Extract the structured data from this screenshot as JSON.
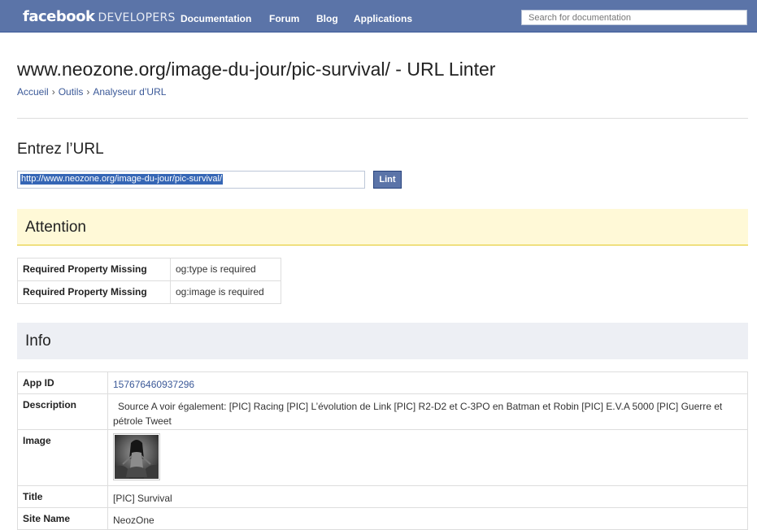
{
  "header": {
    "logo_brand": "facebook",
    "logo_suffix": "DEVELOPERS",
    "nav": [
      "Documentation",
      "Forum",
      "Blog",
      "Applications"
    ],
    "search_placeholder": "Search for documentation"
  },
  "page": {
    "title": "www.neozone.org/image-du-jour/pic-survival/ - URL Linter",
    "breadcrumb": [
      "Accueil",
      "Outils",
      "Analyseur d’URL"
    ]
  },
  "form": {
    "heading": "Entrez l’URL",
    "url_value": "http://www.neozone.org/image-du-jour/pic-survival/",
    "lint_label": "Lint"
  },
  "attention": {
    "heading": "Attention",
    "rows": [
      {
        "key": "Required Property Missing",
        "value": "og:type is required"
      },
      {
        "key": "Required Property Missing",
        "value": "og:image is required"
      }
    ]
  },
  "info": {
    "heading": "Info",
    "app_id_label": "App ID",
    "app_id": "157676460937296",
    "description_label": "Description",
    "description": "Source A voir également: [PIC] Racing [PIC] L’évolution de Link [PIC] R2-D2 et C-3PO en Batman et Robin [PIC] E.V.A 5000 [PIC] Guerre et pétrole Tweet",
    "image_label": "Image",
    "title_label": "Title",
    "title": "[PIC] Survival",
    "site_name_label": "Site Name",
    "site_name": "NeozOne"
  },
  "colors": {
    "header_bg": "#5b74a8",
    "link": "#3b5998",
    "attention_bg": "#fff9d7",
    "info_bg": "#edeff4"
  }
}
